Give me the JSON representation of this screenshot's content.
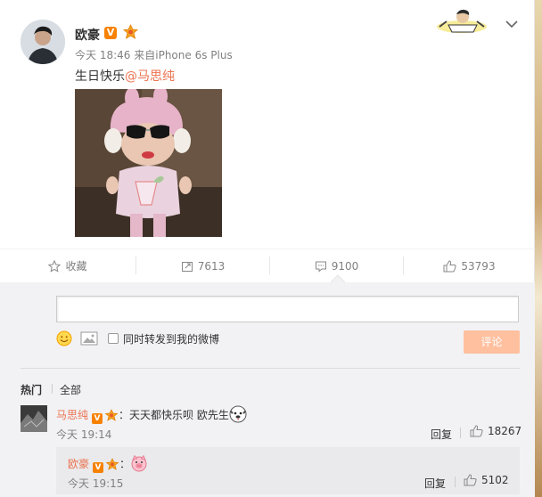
{
  "post": {
    "author": "欧豪",
    "verified_badge": "V",
    "time": "今天 18:46",
    "source_prefix": "来自",
    "source": "iPhone 6s Plus",
    "text_prefix": "生日快乐",
    "mention": "@马思纯"
  },
  "actions": {
    "favorite_label": "收藏",
    "repost_count": "7613",
    "comment_count": "9100",
    "like_count": "53793"
  },
  "composer": {
    "input_value": "",
    "repost_label": "同时转发到我的微博",
    "submit_label": "评论"
  },
  "tabs": {
    "hot": "热门",
    "all": "全部"
  },
  "comments": [
    {
      "author": "马思纯",
      "badge": "V",
      "text": "：天天都快乐呗 欧先生",
      "time": "今天 19:14",
      "reply_label": "回复",
      "likes": "18267"
    },
    {
      "author": "欧豪",
      "badge": "V",
      "text": "：",
      "time": "今天 19:15",
      "reply_label": "回复",
      "likes": "5102"
    }
  ],
  "colors": {
    "accent": "#eb7350",
    "badge": "#f78100",
    "submit_disabled": "#ffc09f",
    "panel_bg": "#f2f2f5"
  },
  "icons": [
    "avatar",
    "verified-badge",
    "medal-icon",
    "chevron-down-icon",
    "star-icon",
    "repost-icon",
    "comment-icon",
    "thumb-up-icon",
    "emoji-icon",
    "image-icon",
    "pig-emoji",
    "dog-emoji"
  ]
}
